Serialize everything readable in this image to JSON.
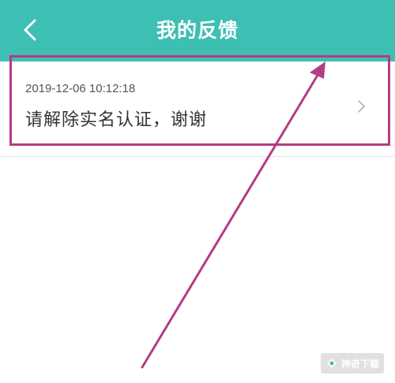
{
  "app_bar": {
    "title": "我的反馈",
    "back_icon": "chevron-left-icon"
  },
  "feedback_list": {
    "items": [
      {
        "time": "2019-12-06 10:12:18",
        "content": "请解除实名认证，谢谢",
        "chevron_icon": "chevron-right-icon"
      }
    ]
  },
  "annotation": {
    "highlight_color": "#b53c84",
    "arrow_color": "#b53c84"
  },
  "watermark": {
    "text": "神奇下载"
  },
  "colors": {
    "primary": "#3dbfb4",
    "background": "#ffffff",
    "text_primary": "#333333",
    "text_secondary": "#555555"
  }
}
